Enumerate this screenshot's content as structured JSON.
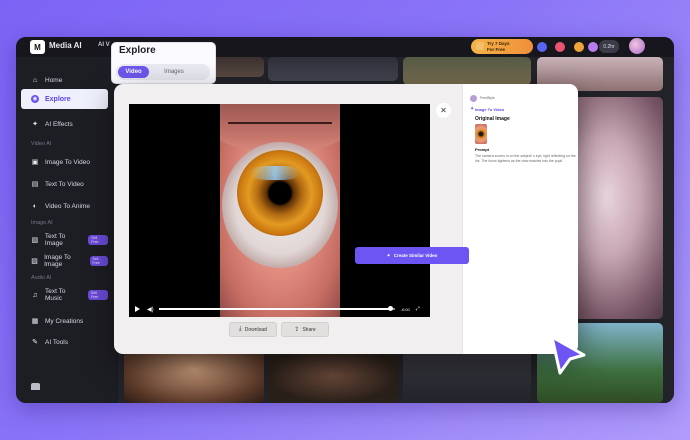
{
  "app": {
    "brand": "Media AI",
    "logo_text": "M",
    "top_nav": "AI V"
  },
  "promo": {
    "line1": "Try 7 Days",
    "line2": "For Free"
  },
  "top_pill": "0.2hr",
  "sidebar": {
    "items": [
      {
        "id": "home",
        "label": "Home",
        "icon": "home-icon",
        "active": false
      },
      {
        "id": "explore",
        "label": "Explore",
        "icon": "compass-icon",
        "active": true
      },
      {
        "id": "ai-effects",
        "label": "AI Effects",
        "icon": "sparkle-icon",
        "active": false
      }
    ],
    "video_ai_title": "Video AI",
    "video_ai": [
      {
        "id": "image-to-video",
        "label": "Image To Video",
        "icon": "video-icon"
      },
      {
        "id": "text-to-video",
        "label": "Text To Video",
        "icon": "text-video-icon"
      },
      {
        "id": "video-to-anime",
        "label": "Video To Anime",
        "icon": "anime-icon"
      }
    ],
    "image_ai_title": "Image AI",
    "image_ai": [
      {
        "id": "text-to-image",
        "label": "Text To Image",
        "icon": "text-image-icon",
        "badge": "Sell Free"
      },
      {
        "id": "image-to-image",
        "label": "Image To Image",
        "icon": "image-icon",
        "badge": "Sell Free"
      }
    ],
    "audio_ai_title": "Audio AI",
    "audio_ai": [
      {
        "id": "text-to-music",
        "label": "Text To Music",
        "icon": "music-icon",
        "badge": "Sell Free"
      }
    ],
    "bottom": [
      {
        "id": "my-creations",
        "label": "My Creations",
        "icon": "grid-icon"
      },
      {
        "id": "ai-tools",
        "label": "AI Tools",
        "icon": "tools-icon"
      }
    ]
  },
  "explore": {
    "title": "Explore",
    "tabs": [
      {
        "label": "Video",
        "active": true
      },
      {
        "label": "Images",
        "active": false
      }
    ]
  },
  "player": {
    "time": "-0:00",
    "progress": 0.98,
    "playing": false
  },
  "actions": {
    "download_label": "Download",
    "share_label": "Share"
  },
  "panel": {
    "username": "FrenBlyle",
    "type_label": "Image To Video",
    "original_label": "Original Image",
    "prompt_label": "Prompt",
    "prompt_text": "The camera zooms in on the subject' s eye, light reflecting on the iris. The focus tightens as the view washes into the pupil.",
    "create_label": "Create Similar Video"
  },
  "colors": {
    "accent": "#6c55f2",
    "background": "#7d63f5",
    "promo": "#f2b446"
  }
}
